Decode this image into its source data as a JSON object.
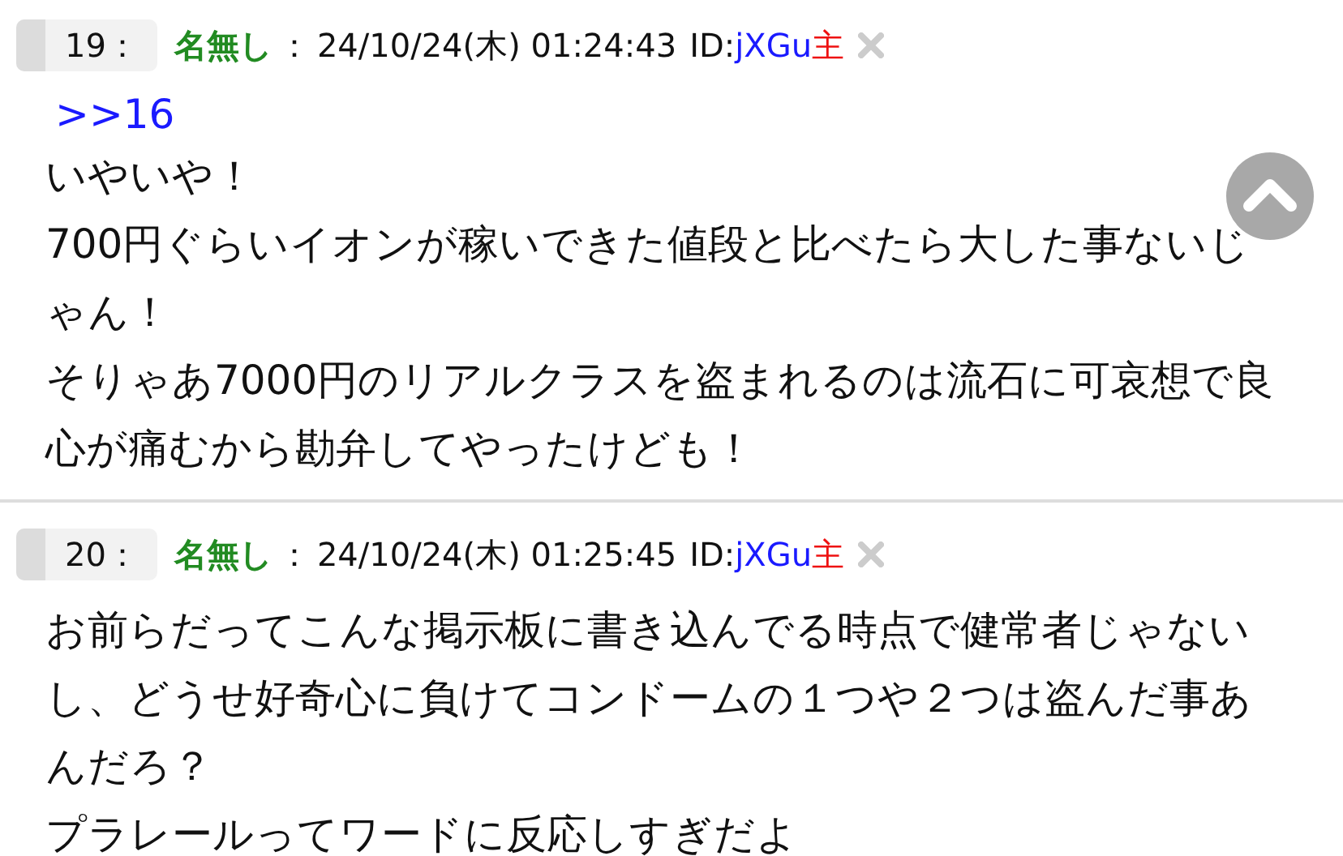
{
  "posts": [
    {
      "number": "19：",
      "name": "名無し",
      "separator": "：",
      "date": "24/10/24(木) 01:24:43",
      "id_label": "ID:",
      "id": "jXGu",
      "op_mark": "主",
      "anchor": ">>16",
      "lines": [
        "いやいや！",
        "700円ぐらいイオンが稼いできた値段と比べたら大した事ないじゃん！",
        "そりゃあ7000円のリアルクラスを盗まれるのは流石に可哀想で良心が痛むから勘弁してやったけども！"
      ]
    },
    {
      "number": "20：",
      "name": "名無し",
      "separator": "：",
      "date": "24/10/24(木) 01:25:45",
      "id_label": "ID:",
      "id": "jXGu",
      "op_mark": "主",
      "lines": [
        "お前らだってこんな掲示板に書き込んでる時点で健常者じゃないし、どうせ好奇心に負けてコンドームの１つや２つは盗んだ事あんだろ？",
        "プラレールってワードに反応しすぎだよ"
      ]
    }
  ]
}
